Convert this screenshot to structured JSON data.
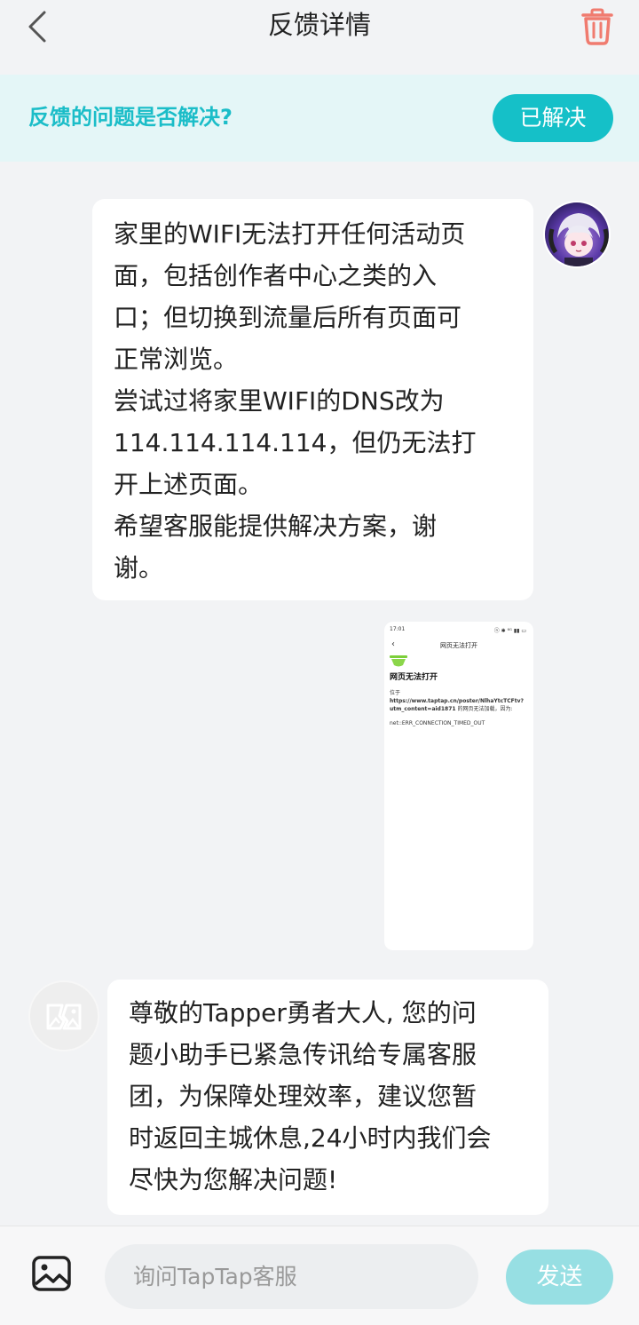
{
  "header": {
    "title": "反馈详情",
    "back_icon": "chevron-left-icon",
    "trash_icon": "trash-icon",
    "trash_color": "#f07b6f"
  },
  "resolve_bar": {
    "question": "反馈的问题是否解决?",
    "button_label": "已解决",
    "accent": "#15c0c8"
  },
  "messages": {
    "user_text": "家里的WIFI无法打开任何活动页\n面，包括创作者中心之类的入\n口；但切换到流量后所有页面可\n正常浏览。\n尝试过将家里WIFI的DNS改为\n114.114.114.114，但仍无法打\n开上述页面。\n希望客服能提供解决方案，谢\n谢。",
    "screenshot": {
      "time": "17:01",
      "status_icons": "ⓝ ✱ ⁶ᴳ ▮▮ ▭",
      "title": "网页无法打开",
      "heading": "网页无法打开",
      "body_prefix": "位于",
      "url": "https://www.taptap.cn/poster/NlhaYtcTCFtv?utm_content=aid1871",
      "body_suffix": " 的网页无法加载，因为:",
      "error": "net::ERR_CONNECTION_TIMED_OUT"
    },
    "bot_text": "尊敬的Tapper勇者大人, 您的问\n题小助手已紧急传讯给专属客服\n团，为保障处理效率，建议您暂\n时返回主城休息,24小时内我们会\n尽快为您解决问题!"
  },
  "composer": {
    "image_icon": "image-icon",
    "placeholder": "询问TapTap客服",
    "send_label": "发送"
  }
}
